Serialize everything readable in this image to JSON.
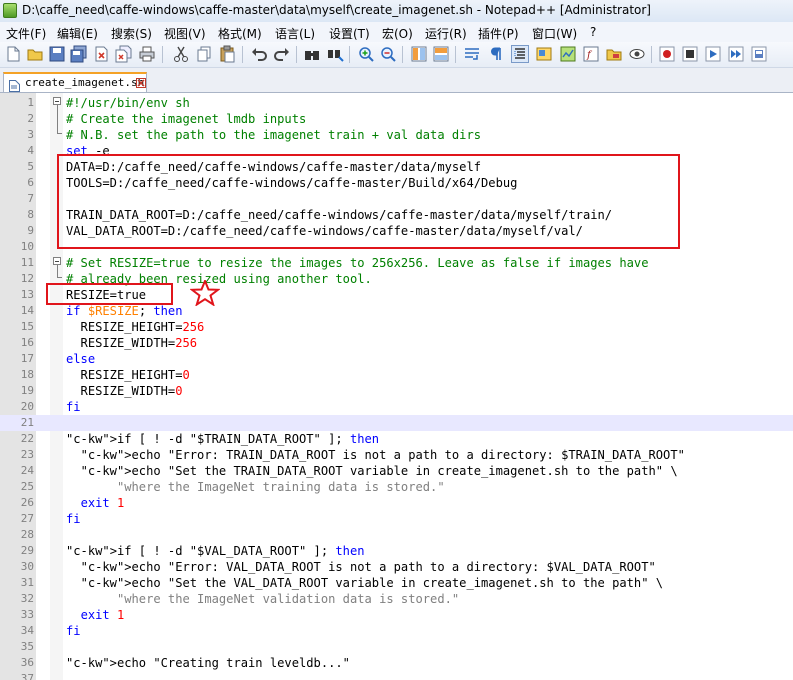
{
  "window": {
    "title": "D:\\caffe_need\\caffe-windows\\caffe-master\\data\\myself\\create_imagenet.sh - Notepad++ [Administrator]"
  },
  "menu": [
    {
      "label": "文件(F)"
    },
    {
      "label": "编辑(E)"
    },
    {
      "label": "搜索(S)"
    },
    {
      "label": "视图(V)"
    },
    {
      "label": "格式(M)"
    },
    {
      "label": "语言(L)"
    },
    {
      "label": "设置(T)"
    },
    {
      "label": "宏(O)"
    },
    {
      "label": "运行(R)"
    },
    {
      "label": "插件(P)"
    },
    {
      "label": "窗口(W)"
    },
    {
      "label": "?"
    }
  ],
  "toolbar": {
    "icons": [
      "new-file-icon",
      "open-file-icon",
      "save-icon",
      "save-all-icon",
      "close-file-icon",
      "close-all-icon",
      "print-icon",
      "cut-icon",
      "copy-icon",
      "paste-icon",
      "undo-icon",
      "redo-icon",
      "find-icon",
      "replace-icon",
      "zoom-in-icon",
      "zoom-out-icon",
      "sync-vertical-icon",
      "sync-horizontal-icon",
      "word-wrap-icon",
      "show-all-characters-icon",
      "indent-guide-icon",
      "user-defined-language-icon",
      "document-map-icon",
      "function-list-icon",
      "folder-as-workspace-icon",
      "monitoring-icon",
      "record-macro-icon",
      "stop-recording-icon",
      "play-macro-icon",
      "run-macro-multiple-icon",
      "save-macro-icon"
    ]
  },
  "tabs": [
    {
      "label": "create_imagenet.sh",
      "active": true
    }
  ],
  "editor": {
    "lines": [
      {
        "n": "1",
        "code": "#!/usr/bin/env sh",
        "kind": "comment"
      },
      {
        "n": "2",
        "code": "# Create the imagenet lmdb inputs",
        "kind": "comment"
      },
      {
        "n": "3",
        "code": "# N.B. set the path to the imagenet train + val data dirs",
        "kind": "comment"
      },
      {
        "n": "4",
        "code": "set -e",
        "kind": "set"
      },
      {
        "n": "5",
        "code": "DATA=D:/caffe_need/caffe-windows/caffe-master/data/myself",
        "kind": "plain"
      },
      {
        "n": "6",
        "code": "TOOLS=D:/caffe_need/caffe-windows/caffe-master/Build/x64/Debug",
        "kind": "plain"
      },
      {
        "n": "7",
        "code": "",
        "kind": "plain"
      },
      {
        "n": "8",
        "code": "TRAIN_DATA_ROOT=D:/caffe_need/caffe-windows/caffe-master/data/myself/train/",
        "kind": "plain"
      },
      {
        "n": "9",
        "code": "VAL_DATA_ROOT=D:/caffe_need/caffe-windows/caffe-master/data/myself/val/",
        "kind": "plain"
      },
      {
        "n": "10",
        "code": "",
        "kind": "plain"
      },
      {
        "n": "11",
        "code": "# Set RESIZE=true to resize the images to 256x256. Leave as false if images have",
        "kind": "comment"
      },
      {
        "n": "12",
        "code": "# already been resized using another tool.",
        "kind": "comment"
      },
      {
        "n": "13",
        "code": "RESIZE=true",
        "kind": "plain"
      },
      {
        "n": "14",
        "code": "if $RESIZE; then",
        "kind": "if-var"
      },
      {
        "n": "15",
        "code": "  RESIZE_HEIGHT=256",
        "kind": "assign-num"
      },
      {
        "n": "16",
        "code": "  RESIZE_WIDTH=256",
        "kind": "assign-num"
      },
      {
        "n": "17",
        "code": "else",
        "kind": "keyword"
      },
      {
        "n": "18",
        "code": "  RESIZE_HEIGHT=0",
        "kind": "assign-num"
      },
      {
        "n": "19",
        "code": "  RESIZE_WIDTH=0",
        "kind": "assign-num"
      },
      {
        "n": "20",
        "code": "fi",
        "kind": "keyword"
      },
      {
        "n": "21",
        "code": "",
        "kind": "plain",
        "highlight": true
      },
      {
        "n": "22",
        "code": "if [ ! -d \"$TRAIN_DATA_ROOT\" ]; then",
        "kind": "if-test"
      },
      {
        "n": "23",
        "code": "  echo \"Error: TRAIN_DATA_ROOT is not a path to a directory: $TRAIN_DATA_ROOT\"",
        "kind": "echo"
      },
      {
        "n": "24",
        "code": "  echo \"Set the TRAIN_DATA_ROOT variable in create_imagenet.sh to the path\" \\",
        "kind": "echo"
      },
      {
        "n": "25",
        "code": "       \"where the ImageNet training data is stored.\"",
        "kind": "string"
      },
      {
        "n": "26",
        "code": "  exit 1",
        "kind": "exit"
      },
      {
        "n": "27",
        "code": "fi",
        "kind": "keyword"
      },
      {
        "n": "28",
        "code": "",
        "kind": "plain"
      },
      {
        "n": "29",
        "code": "if [ ! -d \"$VAL_DATA_ROOT\" ]; then",
        "kind": "if-test"
      },
      {
        "n": "30",
        "code": "  echo \"Error: VAL_DATA_ROOT is not a path to a directory: $VAL_DATA_ROOT\"",
        "kind": "echo"
      },
      {
        "n": "31",
        "code": "  echo \"Set the VAL_DATA_ROOT variable in create_imagenet.sh to the path\" \\",
        "kind": "echo"
      },
      {
        "n": "32",
        "code": "       \"where the ImageNet validation data is stored.\"",
        "kind": "string"
      },
      {
        "n": "33",
        "code": "  exit 1",
        "kind": "exit"
      },
      {
        "n": "34",
        "code": "fi",
        "kind": "keyword"
      },
      {
        "n": "35",
        "code": "",
        "kind": "plain"
      },
      {
        "n": "36",
        "code": "echo \"Creating train leveldb...\"",
        "kind": "echo"
      },
      {
        "n": "37",
        "code": "",
        "kind": "plain"
      }
    ]
  },
  "colors": {
    "comment": "#008000",
    "keyword": "#0000ff",
    "string": "#808080",
    "number": "#ff0000",
    "variable": "#ff8000",
    "annotation": "#e0151b"
  }
}
